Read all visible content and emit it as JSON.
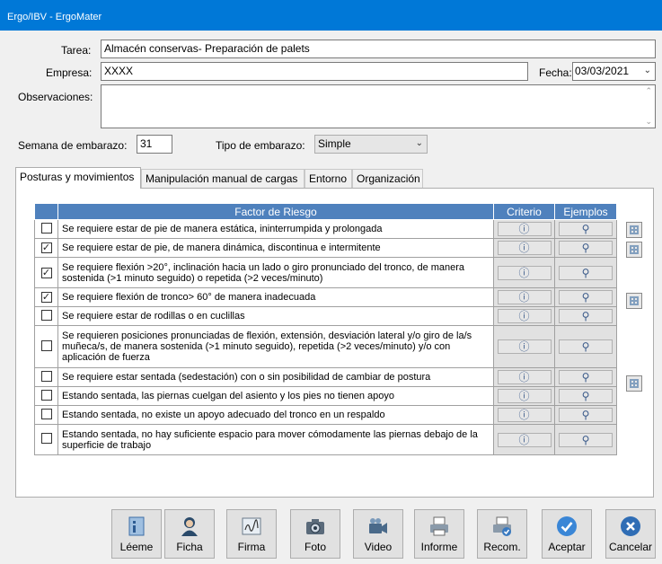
{
  "window": {
    "title": "Ergo/IBV - ErgoMater"
  },
  "form": {
    "tarea_label": "Tarea:",
    "tarea_value": "Almacén conservas- Preparación de palets",
    "empresa_label": "Empresa:",
    "empresa_value": "XXXX",
    "fecha_label": "Fecha:",
    "fecha_value": "03/03/2021",
    "observaciones_label": "Observaciones:",
    "observaciones_value": "",
    "semana_label": "Semana de embarazo:",
    "semana_value": "31",
    "tipo_label": "Tipo de embarazo:",
    "tipo_value": "Simple"
  },
  "tabs": [
    {
      "label": "Posturas y movimientos",
      "active": true
    },
    {
      "label": "Manipulación manual de cargas",
      "active": false
    },
    {
      "label": "Entorno",
      "active": false
    },
    {
      "label": "Organización",
      "active": false
    }
  ],
  "grid": {
    "headers": {
      "factor": "Factor de Riesgo",
      "criterio": "Criterio",
      "ejemplos": "Ejemplos"
    },
    "rows": [
      {
        "checked": false,
        "text": "Se requiere estar de pie de manera estática, ininterrumpida y prolongada",
        "calculator": true
      },
      {
        "checked": true,
        "text": "Se requiere estar de pie, de manera dinámica, discontinua e intermitente",
        "calculator": true
      },
      {
        "checked": true,
        "text": "Se requiere flexión >20°, inclinación hacia un lado o giro pronunciado del tronco, de manera sostenida (>1 minuto seguido) o repetida (>2 veces/minuto)",
        "calculator": false
      },
      {
        "checked": true,
        "text": "Se requiere flexión de tronco> 60° de manera inadecuada",
        "calculator": true
      },
      {
        "checked": false,
        "text": "Se requiere estar de rodillas o en cuclillas",
        "calculator": false
      },
      {
        "checked": false,
        "text": "Se requieren posiciones pronunciadas de flexión, extensión, desviación lateral y/o giro de la/s muñeca/s, de manera sostenida (>1 minuto seguido), repetida (>2 veces/minuto) y/o con aplicación de fuerza",
        "calculator": false
      },
      {
        "checked": false,
        "text": "Se requiere estar sentada (sedestación) con o sin posibilidad de cambiar de postura",
        "calculator": true
      },
      {
        "checked": false,
        "text": "Estando sentada, las piernas cuelgan del asiento y los pies no tienen apoyo",
        "calculator": false
      },
      {
        "checked": false,
        "text": "Estando sentada, no existe un apoyo adecuado del tronco en un respaldo",
        "calculator": false
      },
      {
        "checked": false,
        "text": "Estando sentada, no hay suficiente espacio para mover cómodamente las piernas debajo de la superficie de trabajo",
        "calculator": false
      }
    ]
  },
  "toolbar": {
    "leeme": "Léeme",
    "ficha": "Ficha",
    "firma": "Firma",
    "foto": "Foto",
    "video": "Video",
    "informe": "Informe",
    "recom": "Recom.",
    "aceptar": "Aceptar",
    "cancelar": "Cancelar"
  },
  "colors": {
    "titlebar": "#0078d7",
    "grid_header": "#4f81bd",
    "accept": "#3a86d6",
    "cancel": "#2f6db5"
  }
}
